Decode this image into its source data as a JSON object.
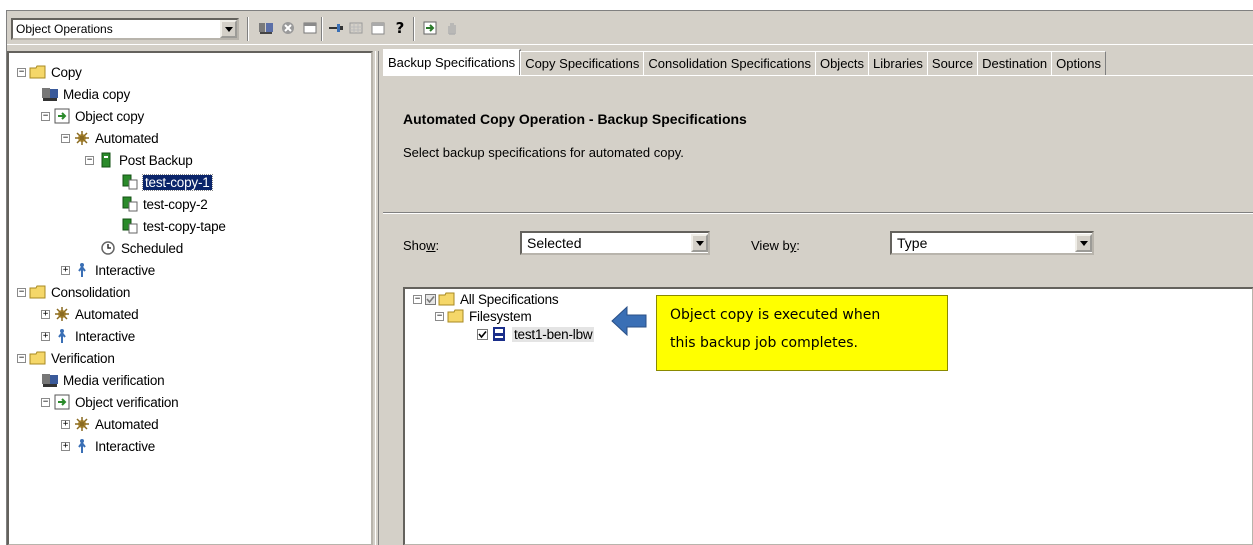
{
  "toolbar": {
    "context_value": "Object Operations"
  },
  "left_tree": {
    "copy": "Copy",
    "media_copy": "Media copy",
    "object_copy": "Object copy",
    "automated": "Automated",
    "post_backup": "Post Backup",
    "test_copy_1": "test-copy-1",
    "test_copy_2": "test-copy-2",
    "test_copy_tape": "test-copy-tape",
    "scheduled": "Scheduled",
    "interactive": "Interactive",
    "consolidation": "Consolidation",
    "consolidation_automated": "Automated",
    "consolidation_interactive": "Interactive",
    "verification": "Verification",
    "media_verification": "Media verification",
    "object_verification": "Object verification",
    "verification_automated": "Automated",
    "verification_interactive": "Interactive"
  },
  "tabs": [
    {
      "label": "Backup Specifications",
      "active": true
    },
    {
      "label": "Copy Specifications"
    },
    {
      "label": "Consolidation Specifications"
    },
    {
      "label": "Objects"
    },
    {
      "label": "Libraries"
    },
    {
      "label": "Source"
    },
    {
      "label": "Destination"
    },
    {
      "label": "Options"
    }
  ],
  "content": {
    "title": "Automated Copy Operation - Backup Specifications",
    "description": "Select backup specifications for automated copy.",
    "show_label_pre": "Sho",
    "show_label_key": "w",
    "show_label_post": ":",
    "show_value": "Selected",
    "viewby_label_pre": "View b",
    "viewby_label_key": "y",
    "viewby_label_post": ":",
    "viewby_value": "Type"
  },
  "spec_tree": {
    "all_specs": "All Specifications",
    "filesystem": "Filesystem",
    "item": "test1-ben-lbw"
  },
  "annotation": {
    "line1": "Object copy is executed when",
    "line2": "this backup job completes."
  },
  "colors": {
    "window_bg": "#d4d0c8",
    "selection": "#0a246a",
    "callout": "#ffff00",
    "arrow": "#3a6fb5"
  }
}
